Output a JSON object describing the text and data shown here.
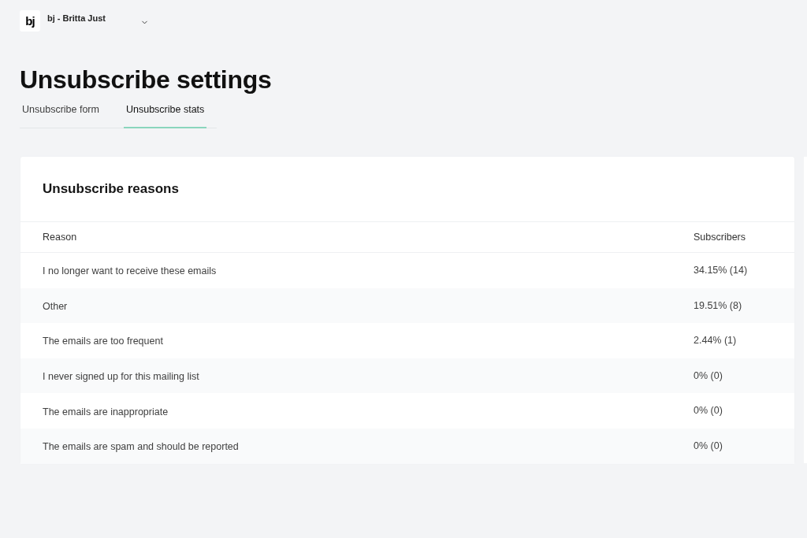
{
  "account": {
    "logo": "bj",
    "name": "bj - Britta Just"
  },
  "title": "Unsubscribe settings",
  "tabs": [
    {
      "label": "Unsubscribe form",
      "selected": false
    },
    {
      "label": "Unsubscribe stats",
      "selected": true
    }
  ],
  "card": {
    "title": "Unsubscribe reasons",
    "table": {
      "columns": [
        "Reason",
        "Subscribers"
      ],
      "rows": [
        {
          "reason": "I no longer want to receive these emails",
          "subscribers": "34.15% (14)"
        },
        {
          "reason": "Other",
          "subscribers": "19.51% (8)"
        },
        {
          "reason": "The emails are too frequent",
          "subscribers": "2.44% (1)"
        },
        {
          "reason": "I never signed up for this mailing list",
          "subscribers": "0% (0)"
        },
        {
          "reason": "The emails are inappropriate",
          "subscribers": "0% (0)"
        },
        {
          "reason": "The emails are spam and should be reported",
          "subscribers": "0% (0)"
        }
      ]
    }
  }
}
